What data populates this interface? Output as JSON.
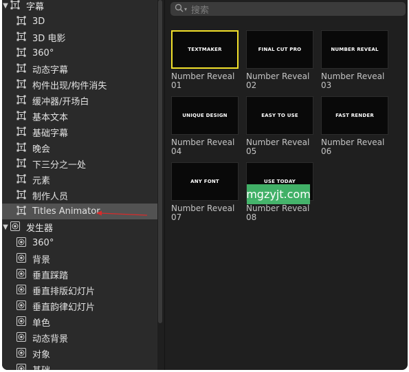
{
  "sidebar": {
    "categories": [
      {
        "label": "字幕",
        "icon": "title-icon",
        "expanded": true,
        "items": [
          {
            "label": "3D",
            "icon": "title-icon"
          },
          {
            "label": "3D 电影",
            "icon": "title-icon"
          },
          {
            "label": "360°",
            "icon": "title-icon"
          },
          {
            "label": "动态字幕",
            "icon": "title-icon"
          },
          {
            "label": "构件出现/构件消失",
            "icon": "title-icon"
          },
          {
            "label": "缓冲器/开场白",
            "icon": "title-icon"
          },
          {
            "label": "基本文本",
            "icon": "title-icon"
          },
          {
            "label": "基础字幕",
            "icon": "title-icon"
          },
          {
            "label": "晚会",
            "icon": "title-icon"
          },
          {
            "label": "下三分之一处",
            "icon": "title-icon"
          },
          {
            "label": "元素",
            "icon": "title-icon"
          },
          {
            "label": "制作人员",
            "icon": "title-icon"
          },
          {
            "label": "Titles Animator",
            "icon": "title-icon",
            "selected": true
          }
        ]
      },
      {
        "label": "发生器",
        "icon": "generator-icon",
        "expanded": true,
        "items": [
          {
            "label": "360°",
            "icon": "generator-icon"
          },
          {
            "label": "背景",
            "icon": "generator-icon"
          },
          {
            "label": "垂直踩踏",
            "icon": "generator-icon"
          },
          {
            "label": "垂直排版幻灯片",
            "icon": "generator-icon"
          },
          {
            "label": "垂直韵律幻灯片",
            "icon": "generator-icon"
          },
          {
            "label": "单色",
            "icon": "generator-icon"
          },
          {
            "label": "动态背景",
            "icon": "generator-icon"
          },
          {
            "label": "对象",
            "icon": "generator-icon"
          },
          {
            "label": "基础",
            "icon": "generator-icon"
          }
        ]
      }
    ]
  },
  "search": {
    "placeholder": "搜索"
  },
  "tiles": [
    {
      "thumb_text": "TEXTMAKER",
      "name": "Number Reveal 01",
      "selected": true
    },
    {
      "thumb_text": "FINAL CUT PRO",
      "name": "Number Reveal 02"
    },
    {
      "thumb_text": "NUMBER REVEAL",
      "name": "Number Reveal 03"
    },
    {
      "thumb_text": "UNIQUE DESIGN",
      "name": "Number Reveal 04"
    },
    {
      "thumb_text": "EASY TO USE",
      "name": "Number Reveal 05"
    },
    {
      "thumb_text": "FAST RENDER",
      "name": "Number Reveal 06"
    },
    {
      "thumb_text": "ANY FONT",
      "name": "Number Reveal 07"
    },
    {
      "thumb_text": "USE TODAY",
      "name": "Number Reveal 08"
    }
  ],
  "watermark": {
    "text": "mgzyjt.com"
  },
  "colors": {
    "selection_border": "#f2e12a",
    "sidebar_bg": "#2a2a2a",
    "browser_bg": "#1f1f1f",
    "selected_row": "#525252",
    "annotation_arrow": "#d92b2b"
  }
}
